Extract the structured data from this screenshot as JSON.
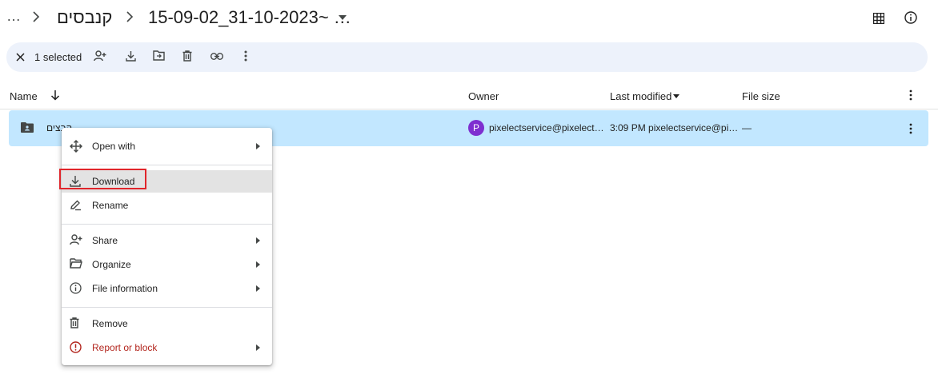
{
  "breadcrumb": {
    "overflow": "…",
    "parent_folder": "קנבסים",
    "current_folder": "15-09-02_31-10-2023~ …"
  },
  "toolbar": {
    "selected_label": "1 selected"
  },
  "table": {
    "headers": {
      "name": "Name",
      "owner": "Owner",
      "last_modified": "Last modified",
      "file_size": "File size"
    },
    "row": {
      "name": "קבצים",
      "owner_initial": "P",
      "owner": "pixelectservice@pixelect…",
      "last_modified": "3:09 PM pixelectservice@pi…",
      "file_size": "—"
    }
  },
  "context_menu": {
    "open_with": "Open with",
    "download": "Download",
    "rename": "Rename",
    "share": "Share",
    "organize": "Organize",
    "file_information": "File information",
    "remove": "Remove",
    "report_or_block": "Report or block"
  },
  "colors": {
    "selected_row": "#c2e7ff",
    "toolbar_bg": "#edf2fb",
    "avatar": "#7e2fd0",
    "danger": "#b3261e",
    "highlight_box": "#e0252b"
  }
}
